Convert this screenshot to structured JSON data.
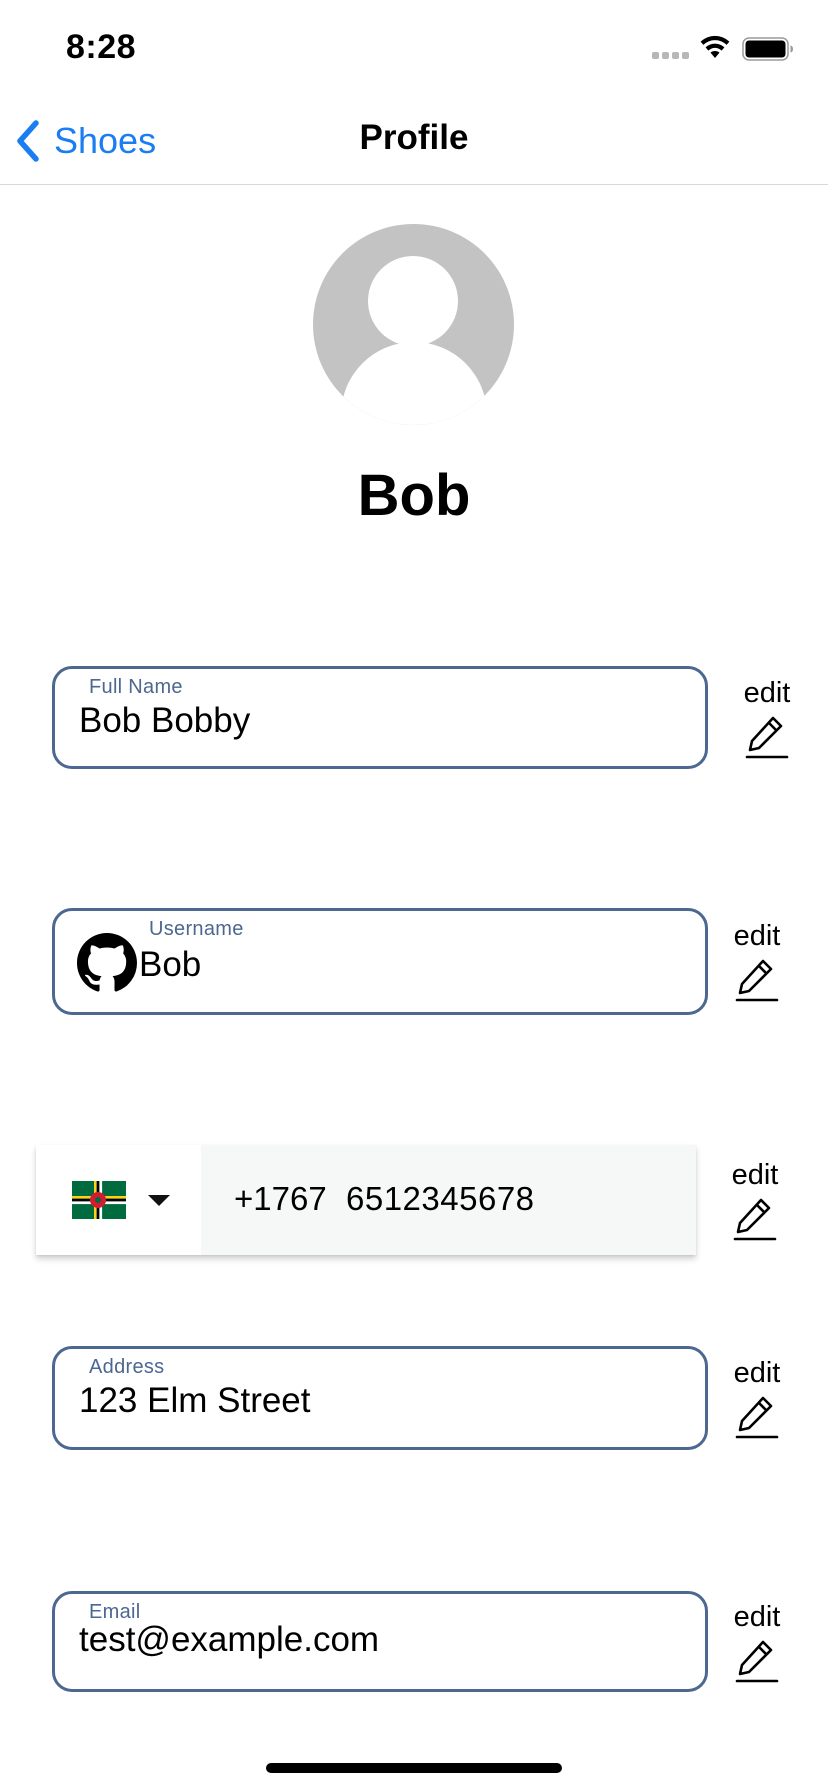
{
  "status_bar": {
    "time": "8:28",
    "icons": [
      "cellular-signal-icon",
      "wifi-icon",
      "battery-icon"
    ]
  },
  "nav": {
    "back_label": "Shoes",
    "title": "Profile",
    "accent_color": "#1a7ef2"
  },
  "profile": {
    "name": "Bob",
    "avatar_icon": "default-avatar-icon"
  },
  "fields": {
    "full_name": {
      "label": "Full Name",
      "value": "Bob Bobby",
      "edit_label": "edit"
    },
    "username": {
      "label": "Username",
      "value": "Bob",
      "icon": "github-icon",
      "edit_label": "edit"
    },
    "phone": {
      "flag_icon": "dominica-flag-icon",
      "dial_code": "+1767",
      "number": "6512345678",
      "edit_label": "edit"
    },
    "address": {
      "label": "Address",
      "value": "123 Elm Street",
      "edit_label": "edit"
    },
    "email": {
      "label": "Email",
      "value": "test@example.com",
      "edit_label": "edit"
    }
  },
  "colors": {
    "field_border": "#4c6790",
    "avatar_gray": "#c3c3c3"
  }
}
